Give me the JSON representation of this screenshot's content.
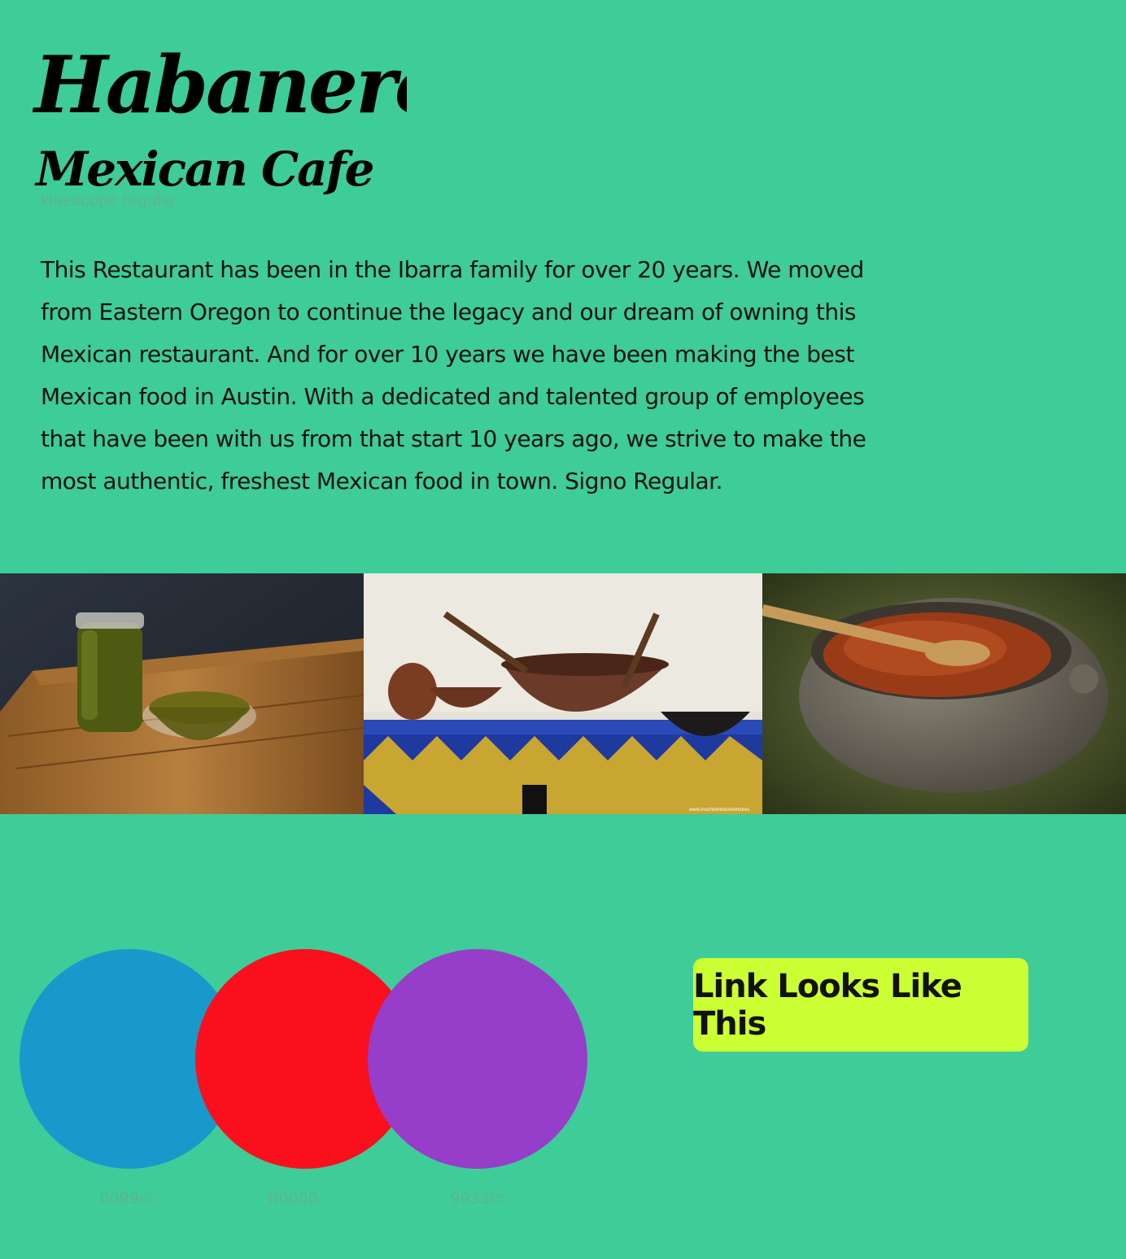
{
  "brand": {
    "name_line1": "Habanero",
    "name_line2": "Mexican Cafe",
    "font_note": "kinescope regular"
  },
  "intro": {
    "paragraph": "This Restaurant has been in the Ibarra family for over 20 years. We moved from Eastern Oregon to continue the legacy and our dream of owning this Mexican restaurant. And for over 10 years we have been making the best Mexican food in Austin. With a dedicated and talented group of employees that have been with us from that start 10 years ago, we strive to make the most authentic, freshest Mexican food in town. Signo Regular."
  },
  "gallery": {
    "photos": [
      {
        "subject": "green salsa in jar and bowl on cutting board"
      },
      {
        "subject": "clay pots on blue and yellow tiled counter",
        "caption": "www.muchomexicoventures"
      },
      {
        "subject": "ground red chile in stone bowl with wooden spoon"
      }
    ]
  },
  "palette": {
    "colors": [
      {
        "hex": "#1899cc",
        "label": "0099cc"
      },
      {
        "hex": "#fa0f1d",
        "label": "ff0000"
      },
      {
        "hex": "#963dc9",
        "label": "9933cc"
      }
    ]
  },
  "link_button": {
    "label": "Link Looks Like This",
    "color": "#ccff33"
  },
  "colors": {
    "background": "#3ecc99",
    "text": "#111111",
    "muted_label": "#5fb38f"
  }
}
